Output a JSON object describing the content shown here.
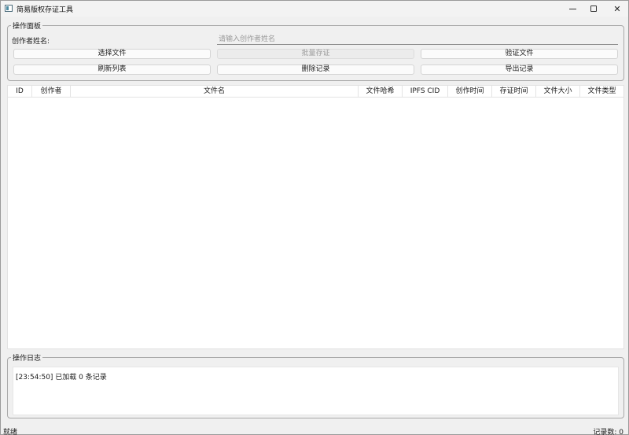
{
  "window": {
    "title": "简易版权存证工具",
    "minimize_icon": "minimize-icon",
    "maximize_icon": "maximize-icon",
    "close_icon": "close-icon",
    "close_glyph": "✕"
  },
  "op_panel": {
    "title": "操作面板",
    "creator_label": "创作者姓名:",
    "creator_value": "",
    "creator_placeholder": "请输入创作者姓名",
    "buttons": {
      "select_file": "选择文件",
      "batch_certify": "批量存证",
      "verify_file": "验证文件",
      "refresh_list": "刷新列表",
      "delete_record": "删除记录",
      "export_record": "导出记录"
    }
  },
  "table": {
    "columns": [
      "ID",
      "创作者",
      "文件名",
      "文件哈希",
      "IPFS CID",
      "创作时间",
      "存证时间",
      "文件大小",
      "文件类型"
    ],
    "rows": []
  },
  "log_panel": {
    "title": "操作日志",
    "lines": [
      "[23:54:50] 已加载 0 条记录"
    ]
  },
  "status": {
    "left": "就绪",
    "right": "记录数: 0"
  }
}
